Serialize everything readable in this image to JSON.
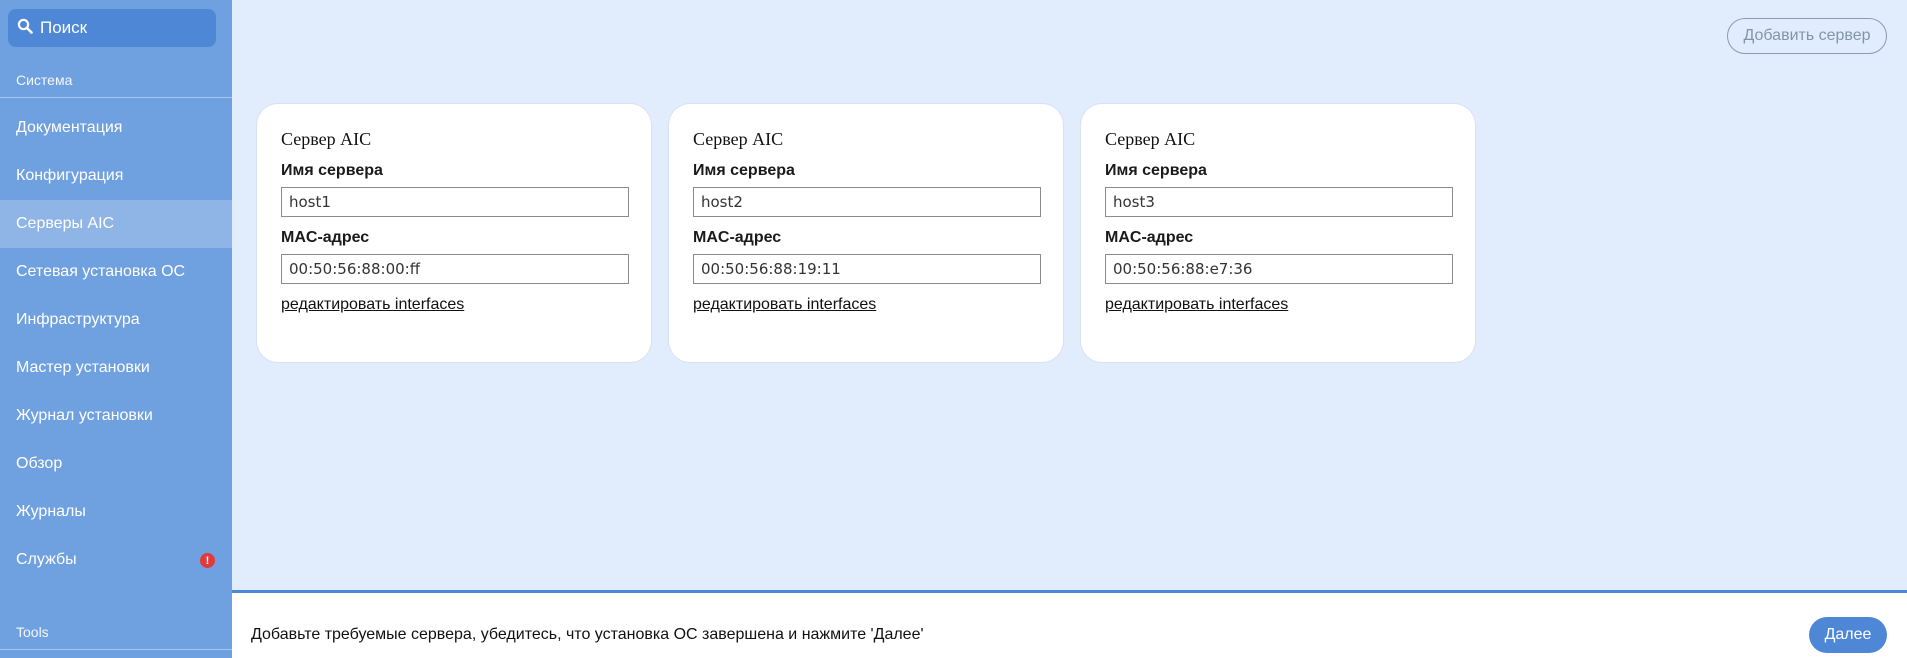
{
  "sidebar": {
    "search_label": "Поиск",
    "section_system": "Система",
    "section_tools": "Tools",
    "items": [
      {
        "label": "Документация"
      },
      {
        "label": "Конфигурация"
      },
      {
        "label": "Серверы AIC"
      },
      {
        "label": "Сетевая установка ОС"
      },
      {
        "label": "Инфраструктура"
      },
      {
        "label": "Мастер установки"
      },
      {
        "label": "Журнал установки"
      },
      {
        "label": "Обзор"
      },
      {
        "label": "Журналы"
      },
      {
        "label": "Службы"
      }
    ],
    "active_item": "Серверы AIC",
    "alert_badge": "!"
  },
  "header": {
    "add_server_label": "Добавить сервер"
  },
  "cards": [
    {
      "title": "Сервер AIC",
      "name_label": "Имя сервера",
      "name_value": "host1",
      "mac_label": "MAC-адрес",
      "mac_value": "00:50:56:88:00:ff",
      "edit_link": "редактировать interfaces"
    },
    {
      "title": "Сервер AIC",
      "name_label": "Имя сервера",
      "name_value": "host2",
      "mac_label": "MAC-адрес",
      "mac_value": "00:50:56:88:19:11",
      "edit_link": "редактировать interfaces"
    },
    {
      "title": "Сервер AIC",
      "name_label": "Имя сервера",
      "name_value": "host3",
      "mac_label": "MAC-адрес",
      "mac_value": "00:50:56:88:e7:36",
      "edit_link": "редактировать interfaces"
    }
  ],
  "footer": {
    "instruction": "Добавьте требуемые сервера, убедитесь, что установка ОС завершена и нажмите 'Далее'",
    "next_label": "Далее"
  },
  "colors": {
    "sidebar_bg": "#6fa0df",
    "active_item_bg": "#8fb4e6",
    "accent": "#4d87d6",
    "page_bg": "#e1edfd",
    "alert": "#e03a3a"
  },
  "icons": {
    "search": "search-icon",
    "alert": "alert-icon"
  }
}
